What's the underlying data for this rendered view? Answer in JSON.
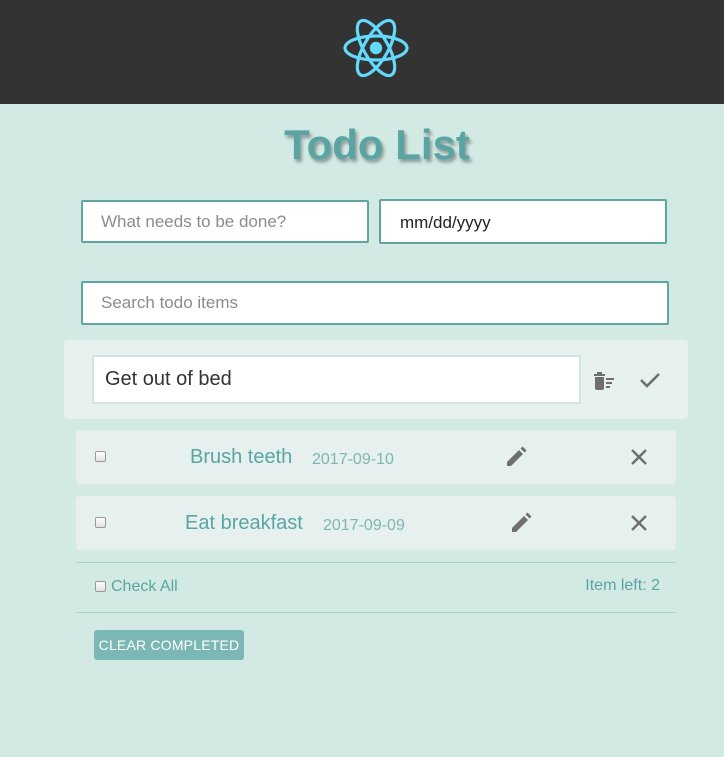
{
  "app": {
    "title": "Todo List",
    "logo_icon": "react-atom-icon",
    "logo_color": "#61dafb"
  },
  "form": {
    "new_todo_placeholder": "What needs to be done?",
    "date_value": "mm/dd/yyyy",
    "search_placeholder": "Search todo items"
  },
  "editing": {
    "value": "Get out of bed",
    "delete_icon": "delete-sweep-icon",
    "confirm_icon": "check-icon"
  },
  "todos": [
    {
      "text": "Brush teeth",
      "date": "2017-09-10",
      "completed": false,
      "edit_icon": "pencil-icon",
      "remove_icon": "close-icon"
    },
    {
      "text": "Eat breakfast",
      "date": "2017-09-09",
      "completed": false,
      "edit_icon": "pencil-icon",
      "remove_icon": "close-icon"
    }
  ],
  "footer": {
    "check_all_label": "Check All",
    "items_left_label": "Item left:",
    "items_left_count": "2",
    "clear_completed_label": "CLEAR COMPLETED"
  },
  "colors": {
    "header_bg": "#333333",
    "page_bg": "#d3e9e3",
    "accent": "#5aa5a4",
    "row_bg": "#e6f1ef",
    "button_bg": "#7bb8b5"
  }
}
